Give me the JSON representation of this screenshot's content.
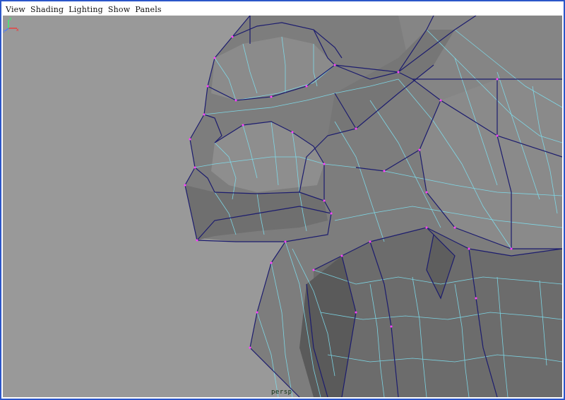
{
  "menu": {
    "items": [
      "View",
      "Shading",
      "Lighting",
      "Show",
      "Panels"
    ]
  },
  "viewport": {
    "camera_label": "persp",
    "background_color": "#999999",
    "mesh_face_color": "#7d7d7d",
    "wire_dark_color": "#1c1c6e",
    "wire_light_color": "#7ee0f0",
    "vertex_color": "#ff40ff",
    "frame_color": "#2b56c9"
  },
  "axis": {
    "x_label": "x",
    "y_label": "y",
    "z_label": "z",
    "x_color": "#ff2a2a",
    "y_color": "#2aff6a",
    "z_color": "#4a7bff"
  }
}
